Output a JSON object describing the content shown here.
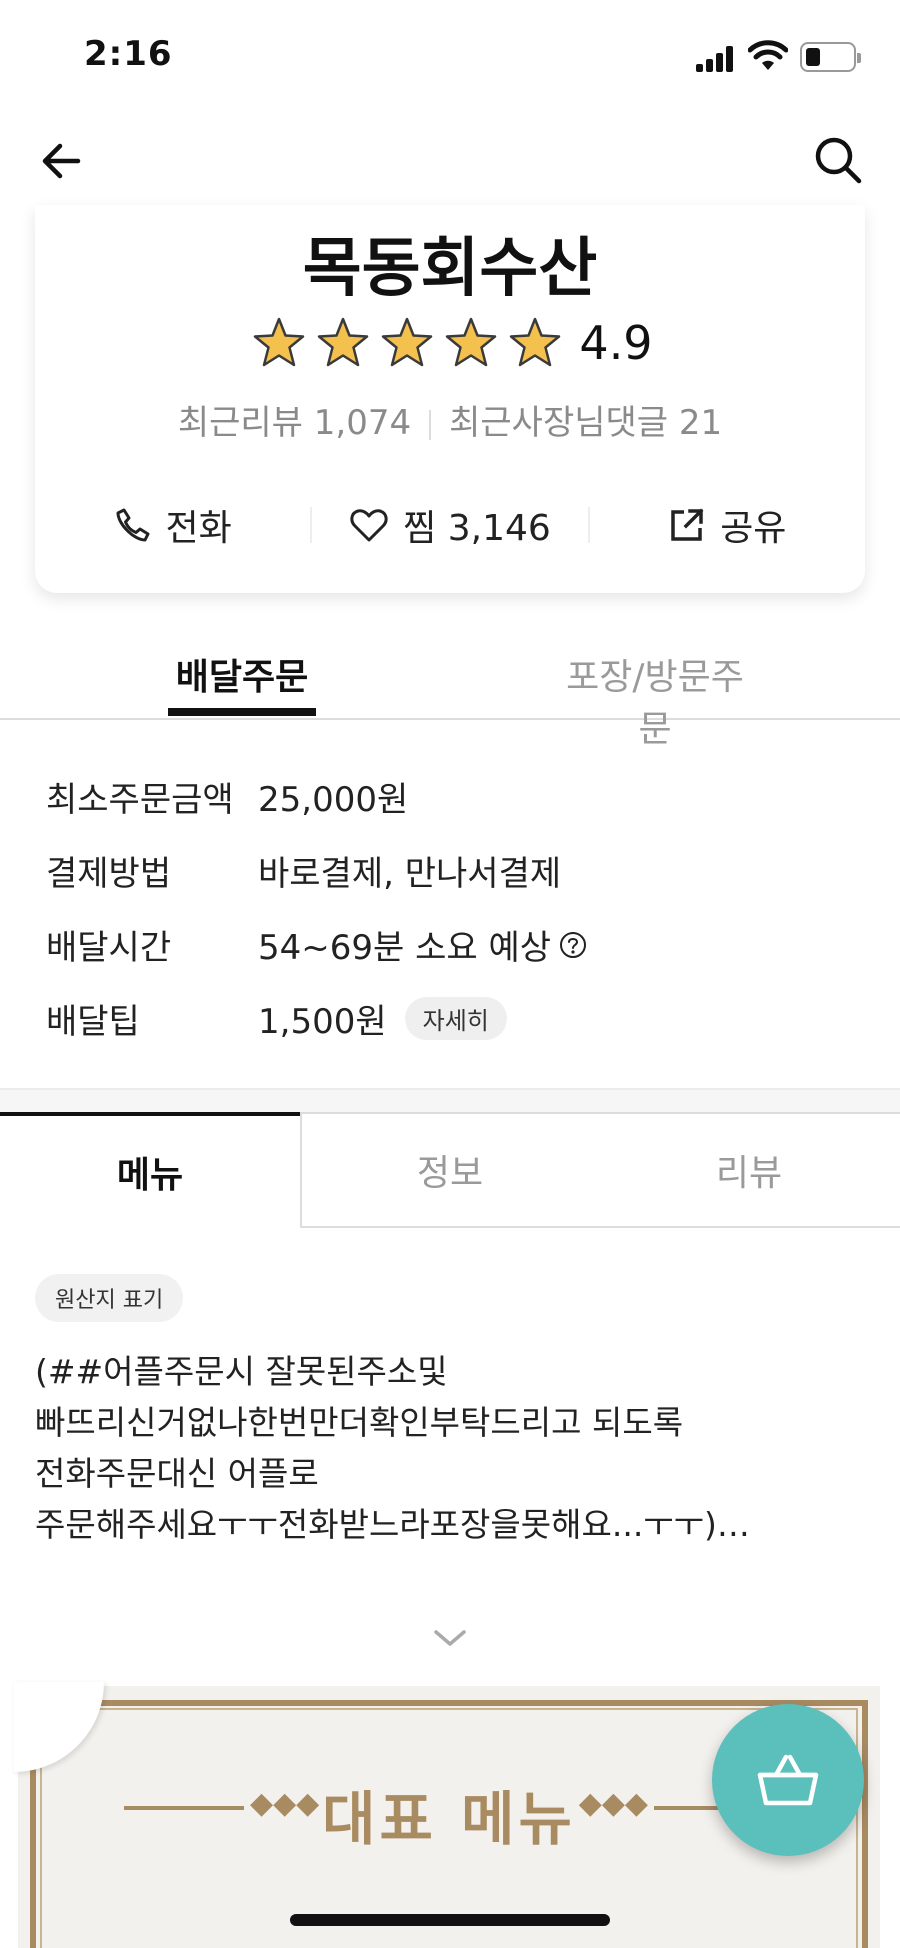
{
  "status_bar": {
    "time": "2:16"
  },
  "store": {
    "name": "목동회수산",
    "rating": "4.9",
    "stars": 5,
    "recent_reviews": "최근리뷰 1,074",
    "owner_replies": "최근사장님댓글 21"
  },
  "actions": {
    "call": "전화",
    "like": "찜 3,146",
    "share": "공유"
  },
  "order_tabs": {
    "delivery": "배달주문",
    "pickup": "포장/방문주문"
  },
  "info": {
    "min_order_label": "최소주문금액",
    "min_order_value": "25,000원",
    "payment_label": "결제방법",
    "payment_value": "바로결제, 만나서결제",
    "delivery_time_label": "배달시간",
    "delivery_time_value": "54~69분 소요 예상",
    "tip_label": "배달팁",
    "tip_value": "1,500원",
    "tip_detail": "자세히"
  },
  "menu_tabs": {
    "menu": "메뉴",
    "info": "정보",
    "review": "리뷰"
  },
  "origin_chip": "원산지 표기",
  "notice": {
    "line1": "(##어플주문시 잘못된주소및",
    "line2": "빠뜨리신거없나한번만더확인부탁드리고 되도록",
    "line3": "전화주문대신 어플로",
    "line4": "주문해주세요ㅜㅜ전화받느라포장을못해요...ㅜㅜ)…"
  },
  "banner": {
    "title": "대표 메뉴"
  },
  "colors": {
    "accent_teal": "#5bbfbb",
    "banner_gold": "#a98b62",
    "star_gold": "#f4c14f"
  },
  "icons": [
    "back-arrow-icon",
    "search-icon",
    "star-icon",
    "phone-icon",
    "heart-icon",
    "share-icon",
    "help-circle-icon",
    "chevron-down-icon",
    "basket-icon"
  ]
}
